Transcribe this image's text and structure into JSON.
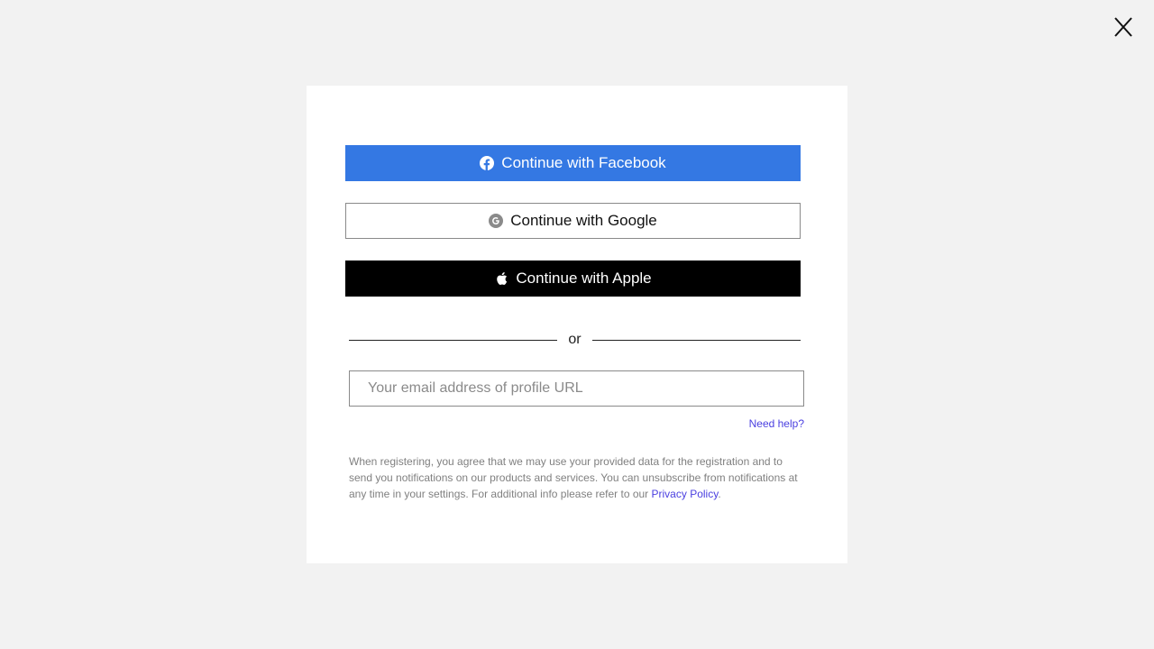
{
  "close": {
    "icon": "close-icon"
  },
  "buttons": {
    "facebook": {
      "label": "Continue with Facebook",
      "icon": "facebook-icon",
      "color": "#3478e3"
    },
    "google": {
      "label": "Continue with Google",
      "icon": "google-icon"
    },
    "apple": {
      "label": "Continue with Apple",
      "icon": "apple-icon",
      "color": "#000000"
    }
  },
  "divider": {
    "label": "or"
  },
  "email": {
    "placeholder": "Your email address of profile URL",
    "value": ""
  },
  "help": {
    "label": "Need help?"
  },
  "legal": {
    "text": "When registering, you agree that we may use your provided data for the registration and to send you notifications on our products and services. You can unsubscribe from notifications at any time in your settings. For additional info please refer to our ",
    "link_label": "Privacy Policy",
    "suffix": "."
  },
  "colors": {
    "background": "#f2f2f2",
    "link": "#4a3fe0",
    "facebook": "#3478e3"
  }
}
